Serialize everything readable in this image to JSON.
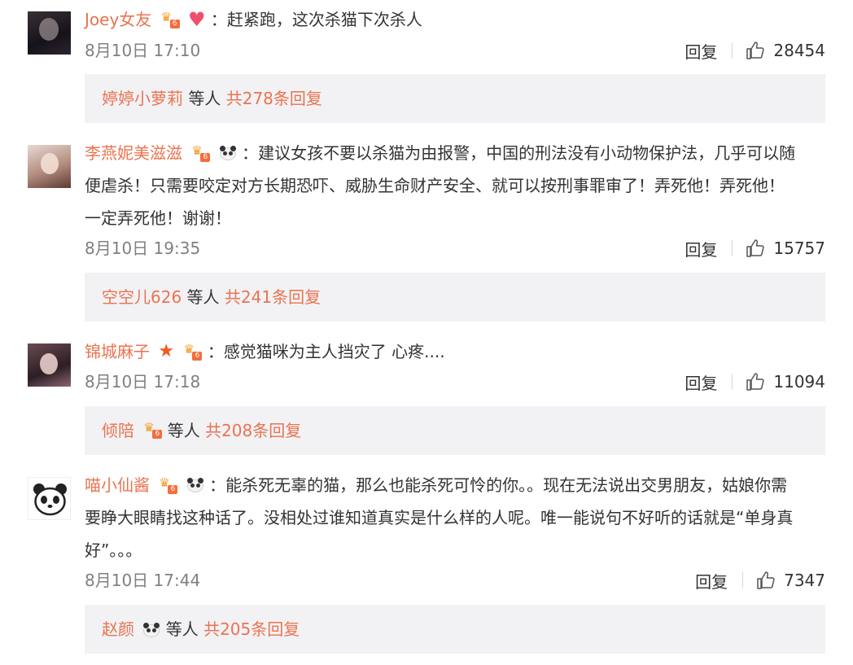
{
  "comments": [
    {
      "username": "Joey女友",
      "text": "赶紧跑，这次杀猫下次杀人",
      "time": "8月10日 17:10",
      "reply_label": "回复",
      "likes": "28454",
      "reply_preview": {
        "names": "婷婷小萝莉",
        "middle": "等人",
        "total": "共278条回复"
      }
    },
    {
      "username": "李燕妮美滋滋",
      "text_lines": [
        "建议女孩不要以杀猫为由报警，中国的刑法没有小动物保护法，几乎可以随",
        "便虐杀！只需要咬定对方长期恐吓、威胁生命财产安全、就可以按刑事罪审了！弄死他！弄死他！",
        "一定弄死他！谢谢！"
      ],
      "time": "8月10日 19:35",
      "reply_label": "回复",
      "likes": "15757",
      "reply_preview": {
        "names": "空空儿626",
        "middle": "等人",
        "total": "共241条回复"
      }
    },
    {
      "username": "锦城麻子",
      "text": "感觉猫咪为主人挡灾了 心疼....",
      "time": "8月10日 17:18",
      "reply_label": "回复",
      "likes": "11094",
      "reply_preview": {
        "names": "倾陪",
        "middle": "等人",
        "total": "共208条回复"
      }
    },
    {
      "username": "喵小仙酱",
      "text_lines": [
        "能杀死无辜的猫，那么也能杀死可怜的你。。现在无法说出交男朋友，姑娘你需",
        "要睁大眼睛找这种话了。没相处过谁知道真实是什么样的人呢。唯一能说句不好听的话就是“单身真",
        "好”。。。"
      ],
      "time": "8月10日 17:44",
      "reply_label": "回复",
      "likes": "7347",
      "reply_preview": {
        "names": "赵颜",
        "middle": "等人",
        "total": "共205条回复"
      }
    }
  ],
  "colors": {
    "accent": "#eb7350",
    "text": "#333333",
    "muted": "#808080",
    "reply_bg": "#f2f2f5"
  },
  "icons": [
    "vip-crown-icon",
    "heart-icon",
    "panda-emoji-icon",
    "star-icon",
    "thumbs-up-icon"
  ]
}
